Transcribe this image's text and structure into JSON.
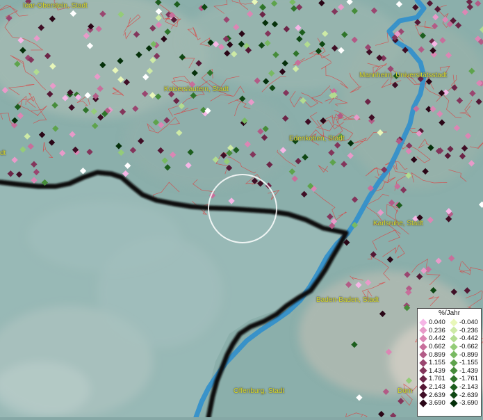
{
  "cities": [
    {
      "id": "idar",
      "label": "Idar-Oberstein, Stadt"
    },
    {
      "id": "mannheim",
      "label": "Mannheim, Universitätsstadt"
    },
    {
      "id": "kaiserslautern",
      "label": "Kaiserslautern, Stadt"
    },
    {
      "id": "edenkoben",
      "label": "Edenkoben, Stadt"
    },
    {
      "id": "karlsruhe",
      "label": "Karlsruhe, Stadt"
    },
    {
      "id": "baden",
      "label": "Baden-Baden, Stadt"
    },
    {
      "id": "offenburg",
      "label": "Offenburg, Stadt"
    },
    {
      "id": "dorn",
      "label": "Dorn"
    },
    {
      "id": "left",
      "label": "dt"
    }
  ],
  "legend": {
    "title": "%/Jahr",
    "rows": [
      {
        "pos": "0.040",
        "neg": "-0.040",
        "pos_color": "#f6b6e6",
        "neg_color": "#e8f7b9"
      },
      {
        "pos": "0.236",
        "neg": "-0.236",
        "pos_color": "#e89ac9",
        "neg_color": "#cdeaa6"
      },
      {
        "pos": "0.442",
        "neg": "-0.442",
        "pos_color": "#dc86b4",
        "neg_color": "#b2dc90"
      },
      {
        "pos": "0.662",
        "neg": "-0.662",
        "pos_color": "#c76f9b",
        "neg_color": "#94cc78"
      },
      {
        "pos": "0.899",
        "neg": "-0.899",
        "pos_color": "#b25b86",
        "neg_color": "#78b962"
      },
      {
        "pos": "1.155",
        "neg": "-1.155",
        "pos_color": "#9a4670",
        "neg_color": "#5ea34c"
      },
      {
        "pos": "1.439",
        "neg": "-1.439",
        "pos_color": "#83355b",
        "neg_color": "#468c3a"
      },
      {
        "pos": "1.761",
        "neg": "-1.761",
        "pos_color": "#6c2547",
        "neg_color": "#2f742a"
      },
      {
        "pos": "2.143",
        "neg": "-2.143",
        "pos_color": "#551835",
        "neg_color": "#1d5e1e"
      },
      {
        "pos": "2.639",
        "neg": "-2.639",
        "pos_color": "#3f0e25",
        "neg_color": "#0f4713"
      },
      {
        "pos": "3.690",
        "neg": "-3.690",
        "pos_color": "#2a0616",
        "neg_color": "#05300a"
      }
    ]
  },
  "colors": {
    "border": "#111111",
    "river": "#2f8fcc",
    "municipal_lines": "#e03a3a",
    "highlight_circle": "#ffffff"
  }
}
